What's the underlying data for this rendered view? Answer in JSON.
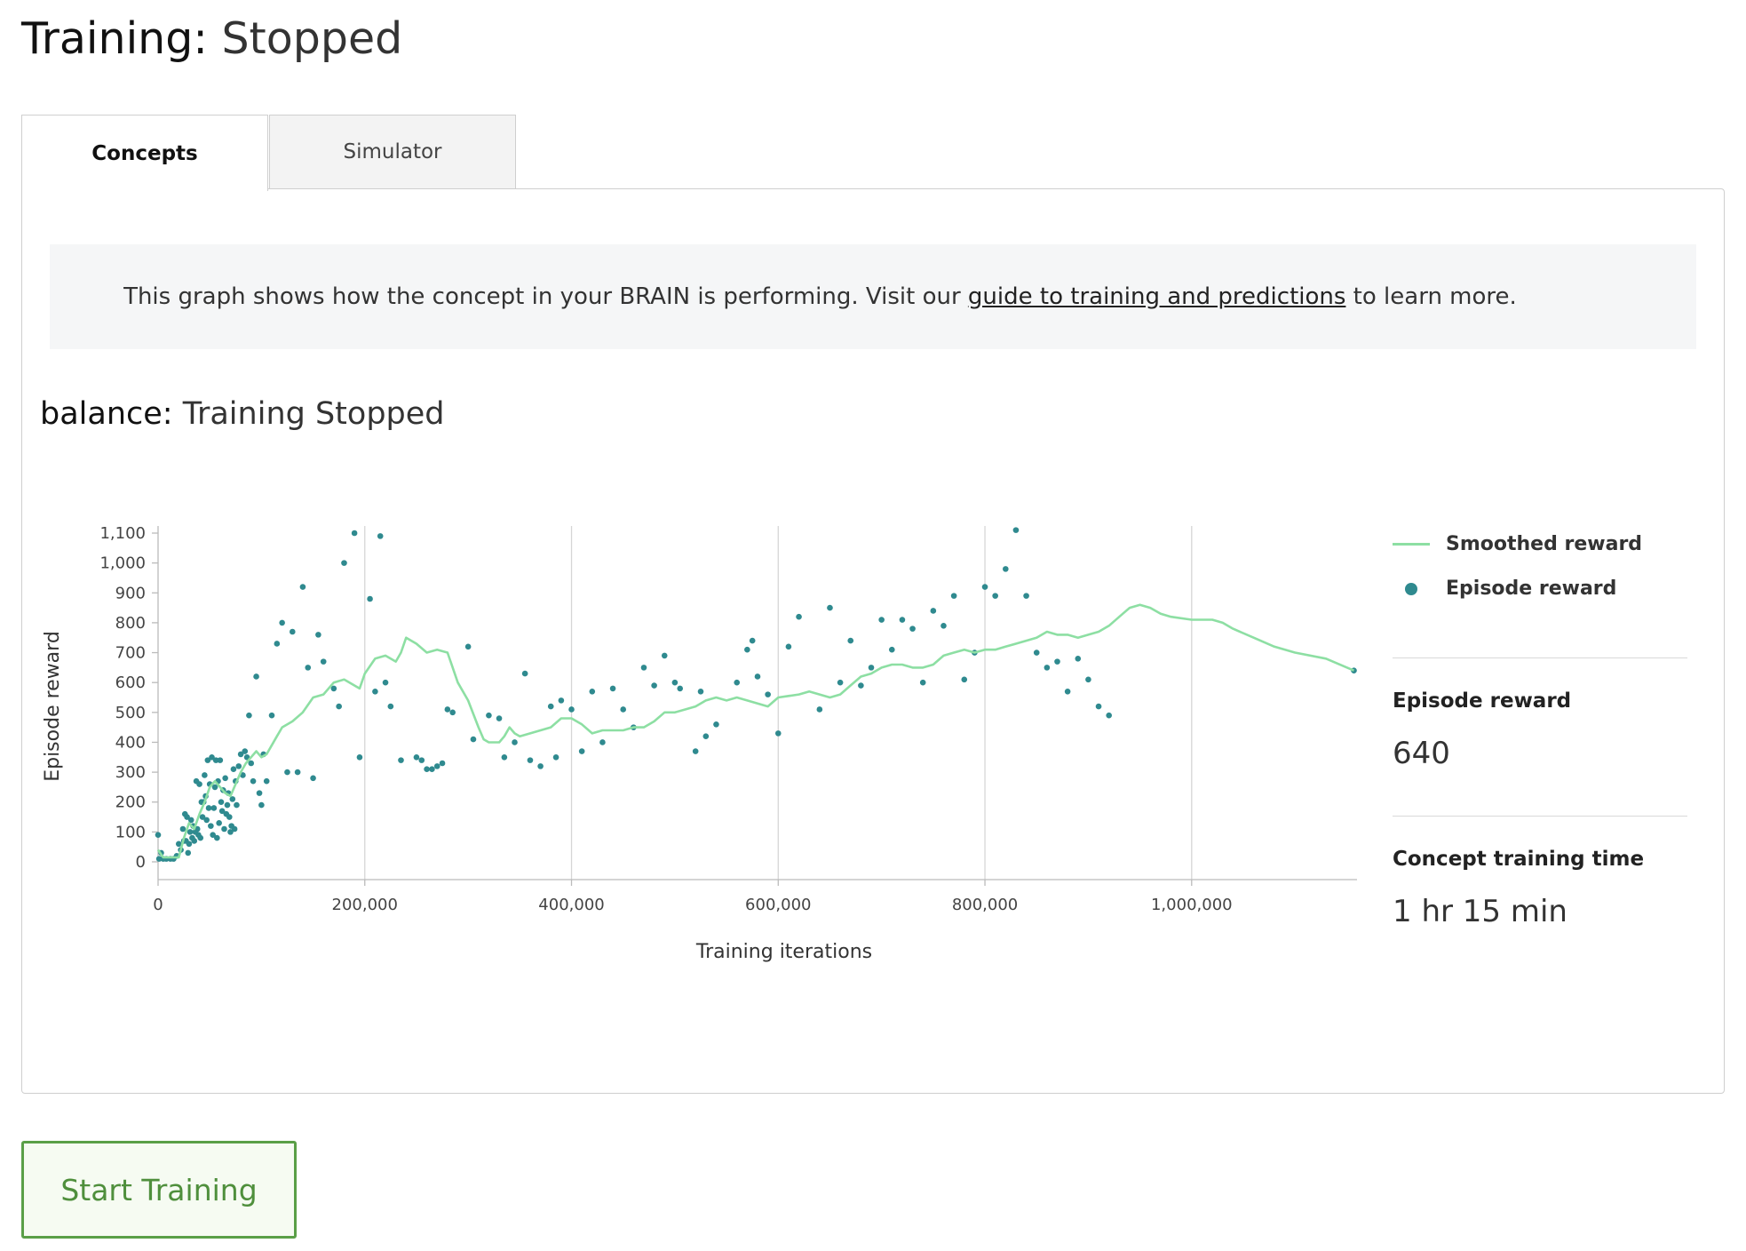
{
  "page": {
    "title_key": "Training:",
    "title_value": "Stopped"
  },
  "tabs": [
    {
      "label": "Concepts",
      "active": true
    },
    {
      "label": "Simulator",
      "active": false
    }
  ],
  "info": {
    "text_before": "This graph shows how the concept in your BRAIN is performing. Visit our ",
    "link_text": "guide to training and predictions",
    "text_after": " to learn more."
  },
  "concept": {
    "name": "balance:",
    "status": "Training Stopped"
  },
  "legend": {
    "smoothed": "Smoothed reward",
    "episode": "Episode reward"
  },
  "stats": {
    "episode_reward_label": "Episode reward",
    "episode_reward_value": "640",
    "training_time_label": "Concept training time",
    "training_time_value": "1 hr 15 min"
  },
  "actions": {
    "start_training": "Start Training"
  },
  "colors": {
    "smoothed_line": "#8ddfa3",
    "episode_dots": "#2f8a8f",
    "button_green": "#5a9f47"
  },
  "chart_data": {
    "type": "scatter",
    "xlabel": "Training iterations",
    "ylabel": "Episode reward",
    "xlim": [
      0,
      1160000
    ],
    "ylim": [
      0,
      1150
    ],
    "x_ticks": [
      0,
      200000,
      400000,
      600000,
      800000,
      1000000
    ],
    "x_tick_labels": [
      "0",
      "200,000",
      "400,000",
      "600,000",
      "800,000",
      "1,000,000"
    ],
    "y_ticks": [
      0,
      100,
      200,
      300,
      400,
      500,
      600,
      700,
      800,
      900,
      1000,
      1100
    ],
    "y_tick_labels": [
      "0",
      "100",
      "200",
      "300",
      "400",
      "500",
      "600",
      "700",
      "800",
      "900",
      "1,000",
      "1,100"
    ],
    "grid": "vertical",
    "legend_position": "right",
    "series": [
      {
        "name": "Smoothed reward",
        "kind": "line",
        "points": [
          [
            0,
            40
          ],
          [
            5000,
            15
          ],
          [
            20000,
            15
          ],
          [
            25000,
            80
          ],
          [
            30000,
            130
          ],
          [
            35000,
            110
          ],
          [
            40000,
            160
          ],
          [
            45000,
            200
          ],
          [
            50000,
            250
          ],
          [
            55000,
            270
          ],
          [
            60000,
            250
          ],
          [
            65000,
            230
          ],
          [
            70000,
            220
          ],
          [
            75000,
            260
          ],
          [
            80000,
            300
          ],
          [
            85000,
            330
          ],
          [
            90000,
            350
          ],
          [
            95000,
            370
          ],
          [
            100000,
            350
          ],
          [
            105000,
            360
          ],
          [
            110000,
            390
          ],
          [
            115000,
            420
          ],
          [
            120000,
            450
          ],
          [
            130000,
            470
          ],
          [
            140000,
            500
          ],
          [
            150000,
            550
          ],
          [
            160000,
            560
          ],
          [
            170000,
            600
          ],
          [
            180000,
            610
          ],
          [
            190000,
            590
          ],
          [
            195000,
            580
          ],
          [
            200000,
            630
          ],
          [
            210000,
            680
          ],
          [
            220000,
            690
          ],
          [
            230000,
            670
          ],
          [
            235000,
            700
          ],
          [
            240000,
            750
          ],
          [
            250000,
            730
          ],
          [
            260000,
            700
          ],
          [
            270000,
            710
          ],
          [
            280000,
            700
          ],
          [
            290000,
            600
          ],
          [
            300000,
            540
          ],
          [
            310000,
            450
          ],
          [
            315000,
            410
          ],
          [
            320000,
            400
          ],
          [
            330000,
            400
          ],
          [
            335000,
            420
          ],
          [
            340000,
            450
          ],
          [
            345000,
            430
          ],
          [
            350000,
            420
          ],
          [
            360000,
            430
          ],
          [
            370000,
            440
          ],
          [
            380000,
            450
          ],
          [
            390000,
            480
          ],
          [
            400000,
            480
          ],
          [
            410000,
            460
          ],
          [
            420000,
            430
          ],
          [
            430000,
            440
          ],
          [
            440000,
            440
          ],
          [
            450000,
            440
          ],
          [
            460000,
            450
          ],
          [
            470000,
            450
          ],
          [
            480000,
            470
          ],
          [
            490000,
            500
          ],
          [
            500000,
            500
          ],
          [
            510000,
            510
          ],
          [
            520000,
            520
          ],
          [
            530000,
            540
          ],
          [
            540000,
            550
          ],
          [
            550000,
            540
          ],
          [
            560000,
            550
          ],
          [
            570000,
            540
          ],
          [
            580000,
            530
          ],
          [
            590000,
            520
          ],
          [
            600000,
            550
          ],
          [
            620000,
            560
          ],
          [
            630000,
            570
          ],
          [
            640000,
            560
          ],
          [
            650000,
            550
          ],
          [
            660000,
            560
          ],
          [
            670000,
            590
          ],
          [
            680000,
            620
          ],
          [
            690000,
            630
          ],
          [
            700000,
            650
          ],
          [
            710000,
            660
          ],
          [
            720000,
            660
          ],
          [
            730000,
            650
          ],
          [
            740000,
            650
          ],
          [
            750000,
            660
          ],
          [
            760000,
            690
          ],
          [
            770000,
            700
          ],
          [
            780000,
            710
          ],
          [
            790000,
            700
          ],
          [
            800000,
            710
          ],
          [
            810000,
            710
          ],
          [
            820000,
            720
          ],
          [
            830000,
            730
          ],
          [
            840000,
            740
          ],
          [
            850000,
            750
          ],
          [
            860000,
            770
          ],
          [
            870000,
            760
          ],
          [
            880000,
            760
          ],
          [
            890000,
            750
          ],
          [
            900000,
            760
          ],
          [
            910000,
            770
          ],
          [
            920000,
            790
          ],
          [
            930000,
            820
          ],
          [
            940000,
            850
          ],
          [
            950000,
            860
          ],
          [
            960000,
            850
          ],
          [
            970000,
            830
          ],
          [
            980000,
            820
          ],
          [
            1000000,
            810
          ],
          [
            1020000,
            810
          ],
          [
            1030000,
            800
          ],
          [
            1040000,
            780
          ],
          [
            1060000,
            750
          ],
          [
            1080000,
            720
          ],
          [
            1100000,
            700
          ],
          [
            1130000,
            680
          ],
          [
            1157000,
            640
          ]
        ]
      },
      {
        "name": "Episode reward",
        "kind": "scatter",
        "points": [
          [
            0,
            90
          ],
          [
            1000,
            10
          ],
          [
            3000,
            30
          ],
          [
            5000,
            10
          ],
          [
            8000,
            10
          ],
          [
            12000,
            10
          ],
          [
            15000,
            10
          ],
          [
            18000,
            20
          ],
          [
            20000,
            60
          ],
          [
            22000,
            40
          ],
          [
            24000,
            110
          ],
          [
            25000,
            70
          ],
          [
            26000,
            160
          ],
          [
            27000,
            70
          ],
          [
            28000,
            150
          ],
          [
            29000,
            30
          ],
          [
            30000,
            60
          ],
          [
            31000,
            100
          ],
          [
            32000,
            140
          ],
          [
            33000,
            80
          ],
          [
            34000,
            120
          ],
          [
            35000,
            70
          ],
          [
            36000,
            100
          ],
          [
            37000,
            270
          ],
          [
            38000,
            110
          ],
          [
            39000,
            90
          ],
          [
            40000,
            260
          ],
          [
            41000,
            80
          ],
          [
            42000,
            200
          ],
          [
            43000,
            150
          ],
          [
            44000,
            200
          ],
          [
            45000,
            290
          ],
          [
            46000,
            220
          ],
          [
            47000,
            140
          ],
          [
            48000,
            340
          ],
          [
            49000,
            180
          ],
          [
            50000,
            260
          ],
          [
            51000,
            120
          ],
          [
            52000,
            350
          ],
          [
            53000,
            90
          ],
          [
            54000,
            180
          ],
          [
            55000,
            250
          ],
          [
            56000,
            340
          ],
          [
            57000,
            80
          ],
          [
            58000,
            270
          ],
          [
            59000,
            130
          ],
          [
            60000,
            340
          ],
          [
            61000,
            200
          ],
          [
            62000,
            170
          ],
          [
            63000,
            240
          ],
          [
            64000,
            110
          ],
          [
            65000,
            280
          ],
          [
            66000,
            160
          ],
          [
            67000,
            190
          ],
          [
            68000,
            230
          ],
          [
            69000,
            150
          ],
          [
            70000,
            100
          ],
          [
            71000,
            120
          ],
          [
            72000,
            210
          ],
          [
            73000,
            310
          ],
          [
            74000,
            110
          ],
          [
            75000,
            270
          ],
          [
            76000,
            190
          ],
          [
            78000,
            320
          ],
          [
            80000,
            360
          ],
          [
            82000,
            290
          ],
          [
            84000,
            370
          ],
          [
            86000,
            350
          ],
          [
            88000,
            490
          ],
          [
            90000,
            330
          ],
          [
            92000,
            270
          ],
          [
            95000,
            620
          ],
          [
            98000,
            230
          ],
          [
            100000,
            190
          ],
          [
            102000,
            360
          ],
          [
            105000,
            270
          ],
          [
            110000,
            490
          ],
          [
            115000,
            730
          ],
          [
            120000,
            800
          ],
          [
            125000,
            300
          ],
          [
            130000,
            770
          ],
          [
            135000,
            300
          ],
          [
            140000,
            920
          ],
          [
            145000,
            650
          ],
          [
            150000,
            280
          ],
          [
            155000,
            760
          ],
          [
            160000,
            670
          ],
          [
            170000,
            580
          ],
          [
            175000,
            520
          ],
          [
            180000,
            1000
          ],
          [
            190000,
            1100
          ],
          [
            195000,
            350
          ],
          [
            205000,
            880
          ],
          [
            210000,
            570
          ],
          [
            215000,
            1090
          ],
          [
            220000,
            600
          ],
          [
            225000,
            520
          ],
          [
            235000,
            340
          ],
          [
            250000,
            350
          ],
          [
            255000,
            340
          ],
          [
            260000,
            310
          ],
          [
            265000,
            310
          ],
          [
            270000,
            320
          ],
          [
            275000,
            330
          ],
          [
            280000,
            510
          ],
          [
            285000,
            500
          ],
          [
            300000,
            720
          ],
          [
            305000,
            410
          ],
          [
            320000,
            490
          ],
          [
            330000,
            480
          ],
          [
            335000,
            350
          ],
          [
            345000,
            400
          ],
          [
            355000,
            630
          ],
          [
            360000,
            340
          ],
          [
            370000,
            320
          ],
          [
            380000,
            520
          ],
          [
            385000,
            350
          ],
          [
            390000,
            540
          ],
          [
            400000,
            510
          ],
          [
            410000,
            370
          ],
          [
            420000,
            570
          ],
          [
            430000,
            400
          ],
          [
            440000,
            580
          ],
          [
            450000,
            510
          ],
          [
            460000,
            450
          ],
          [
            470000,
            650
          ],
          [
            480000,
            590
          ],
          [
            490000,
            690
          ],
          [
            500000,
            600
          ],
          [
            505000,
            580
          ],
          [
            520000,
            370
          ],
          [
            525000,
            570
          ],
          [
            530000,
            420
          ],
          [
            540000,
            460
          ],
          [
            560000,
            600
          ],
          [
            570000,
            710
          ],
          [
            575000,
            740
          ],
          [
            580000,
            620
          ],
          [
            590000,
            560
          ],
          [
            600000,
            430
          ],
          [
            610000,
            720
          ],
          [
            620000,
            820
          ],
          [
            640000,
            510
          ],
          [
            650000,
            850
          ],
          [
            660000,
            600
          ],
          [
            670000,
            740
          ],
          [
            680000,
            590
          ],
          [
            690000,
            650
          ],
          [
            700000,
            810
          ],
          [
            710000,
            710
          ],
          [
            720000,
            810
          ],
          [
            730000,
            780
          ],
          [
            740000,
            600
          ],
          [
            750000,
            840
          ],
          [
            760000,
            790
          ],
          [
            770000,
            890
          ],
          [
            780000,
            610
          ],
          [
            790000,
            700
          ],
          [
            800000,
            920
          ],
          [
            810000,
            890
          ],
          [
            820000,
            980
          ],
          [
            830000,
            1110
          ],
          [
            840000,
            890
          ],
          [
            850000,
            700
          ],
          [
            860000,
            650
          ],
          [
            870000,
            670
          ],
          [
            880000,
            570
          ],
          [
            890000,
            680
          ],
          [
            900000,
            610
          ],
          [
            910000,
            520
          ],
          [
            920000,
            490
          ],
          [
            1157000,
            640
          ]
        ]
      }
    ]
  }
}
